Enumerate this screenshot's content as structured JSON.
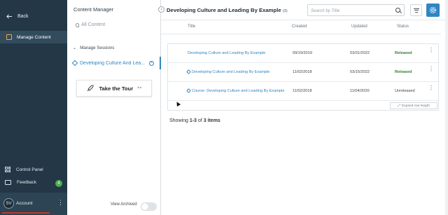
{
  "sidebar": {
    "back_label": "Back",
    "active_item_label": "Manage Content",
    "control_panel_label": "Control Panel",
    "feedback_label": "Feedback",
    "feedback_badge": "4",
    "account_initials": "SV",
    "account_label": "Account"
  },
  "content_manager": {
    "title": "Content Manager",
    "all_content_label": "All Content",
    "section_label": "Manage Sessions",
    "selected_session": "Developing Culture And Lea...",
    "tour_label": "Take the Tour",
    "view_archived_label": "View Archived",
    "view_archived_on": false
  },
  "main": {
    "title": "Developing Culture and Leading By Example",
    "count": "(3)",
    "search_placeholder": "Search by Title",
    "columns": {
      "title": "Title",
      "created": "Created",
      "updated": "Updated",
      "status": "Status"
    },
    "rows": [
      {
        "title": "Developing Culture and Leading By Example",
        "created": "09/19/2019",
        "updated": "03/31/2022",
        "status": "Released"
      },
      {
        "title": "Developing Culture and Leading By Example",
        "created": "11/02/2018",
        "updated": "03/15/2022",
        "status": "Released"
      },
      {
        "title": "Course: Developing Culture and Leading By Example",
        "created": "11/02/2018",
        "updated": "11/04/2020",
        "status": "Unreleased"
      }
    ],
    "expand_label": "Expand row height",
    "showing": {
      "prefix": "Showing",
      "range": "1-3",
      "of": "of",
      "total": "3 items"
    }
  },
  "colors": {
    "sidebar_bg": "#233746",
    "accent": "#2f86c4",
    "released": "#2e7d32"
  }
}
